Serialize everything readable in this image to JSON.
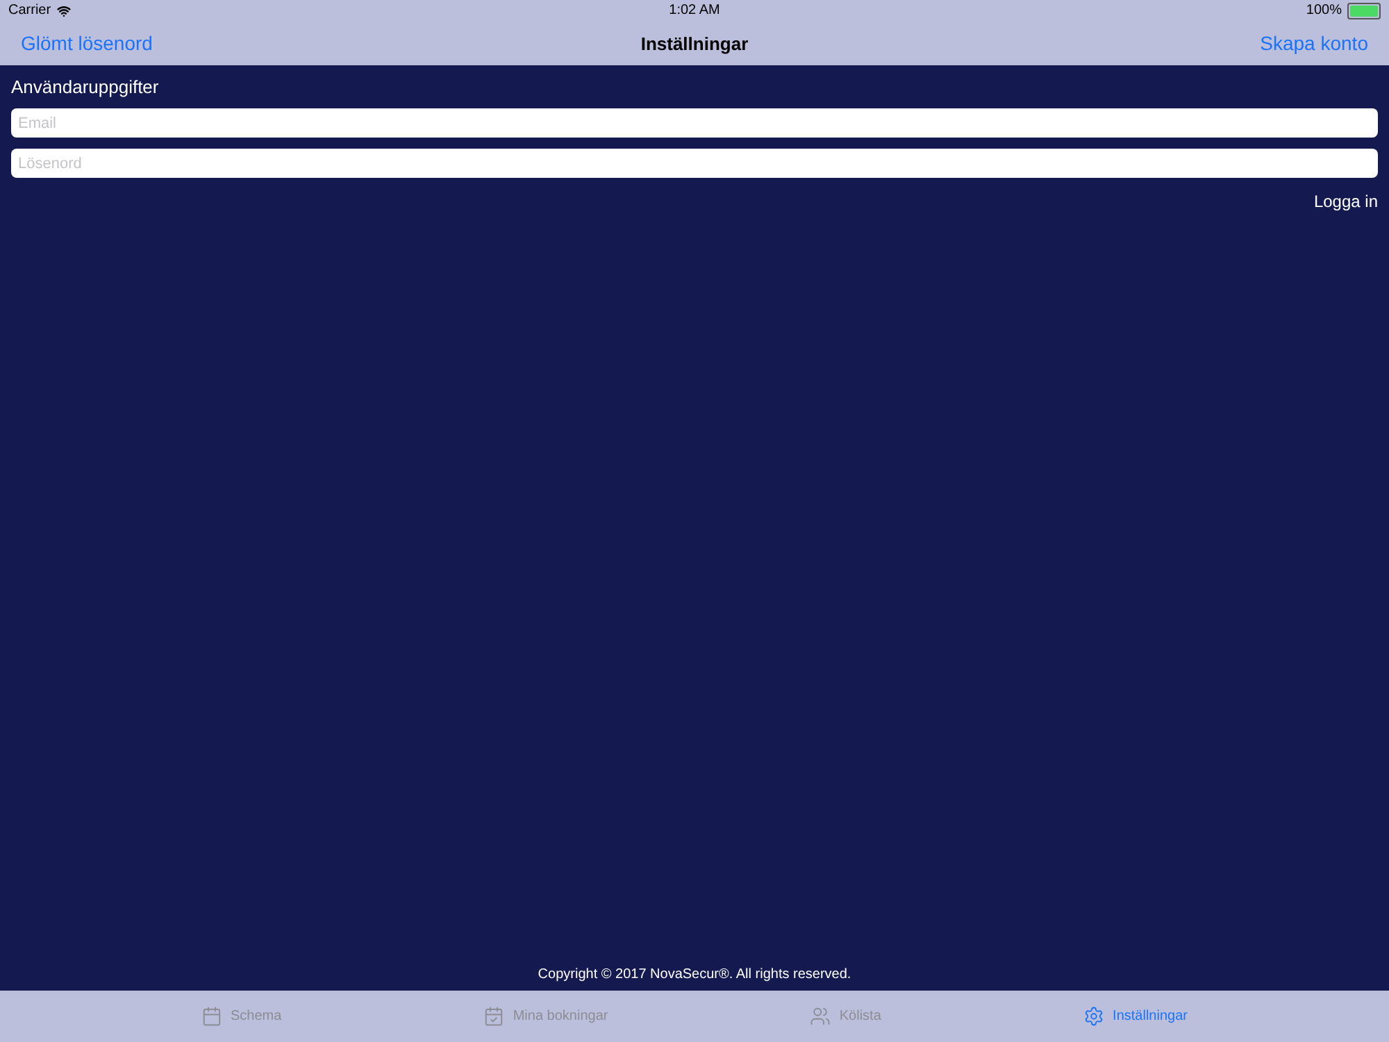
{
  "status_bar": {
    "carrier": "Carrier",
    "time": "1:02 AM",
    "battery": "100%"
  },
  "nav": {
    "left": "Glömt lösenord",
    "title": "Inställningar",
    "right": "Skapa konto"
  },
  "section_title": "Användaruppgifter",
  "fields": [
    {
      "placeholder": "Email"
    },
    {
      "placeholder": "Lösenord"
    }
  ],
  "login_button": "Logga in",
  "copyright": "Copyright © 2017 NovaSecur®. All rights reserved.",
  "tabs": [
    {
      "kind": "calendar",
      "label": "Schema",
      "selected": false
    },
    {
      "kind": "booking",
      "label": "Mina bokningar",
      "selected": false
    },
    {
      "kind": "people",
      "label": "Kölista",
      "selected": false
    },
    {
      "kind": "gear",
      "label": "Inställningar",
      "selected": true
    }
  ]
}
